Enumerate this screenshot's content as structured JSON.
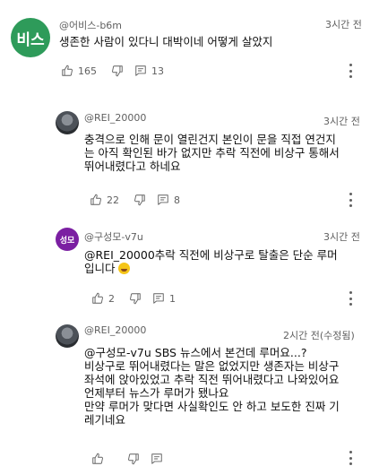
{
  "comments": [
    {
      "avatar_text": "비스",
      "handle": "@어비스-b6m",
      "time": "3시간 전",
      "lines": [
        "생존한 사람이 있다니 대박이네 어떻게 살았지"
      ],
      "likes": "165",
      "replies": "13"
    },
    {
      "handle": "@REI_20000",
      "time": "3시간 전",
      "lines": [
        "충격으로 인해 문이 열린건지 본인이 문을 직접 연건지",
        "는 아직 확인된 바가 없지만 추락 직전에 비상구 통해서",
        "뛰어내렸다고 하네요"
      ],
      "likes": "22",
      "replies": "8"
    },
    {
      "avatar_text": "성모",
      "handle": "@구성모-v7u",
      "time": "3시간 전",
      "lines": [
        "@REI_20000추락 직전에 비상구로 탈출은 단순 루머",
        "입니다"
      ],
      "likes": "2",
      "replies": "1"
    },
    {
      "handle": "@REI_20000",
      "time": "2시간 전(수정됨)",
      "lines": [
        "@구성모-v7u SBS 뉴스에서 본건데 루머요...?",
        "비상구로 뛰어내렸다는 말은 없었지만 생존자는 비상구",
        "좌석에 앉아있었고 추락 직전 뛰어내렸다고 나와있어요",
        "언제부터 뉴스가 루머가 됐나요",
        "만약 루머가 맞다면 사실확인도 안 하고 보도한 진짜 기",
        "레기네요"
      ]
    }
  ],
  "icons": [
    "thumb-up-icon",
    "thumb-down-icon",
    "reply-icon",
    "more-options-icon",
    "grinning-emoji-icon"
  ],
  "colors": {
    "avatar_green": "#2e9b5a",
    "avatar_purple": "#7b1fa2",
    "meta_gray": "#606060"
  }
}
